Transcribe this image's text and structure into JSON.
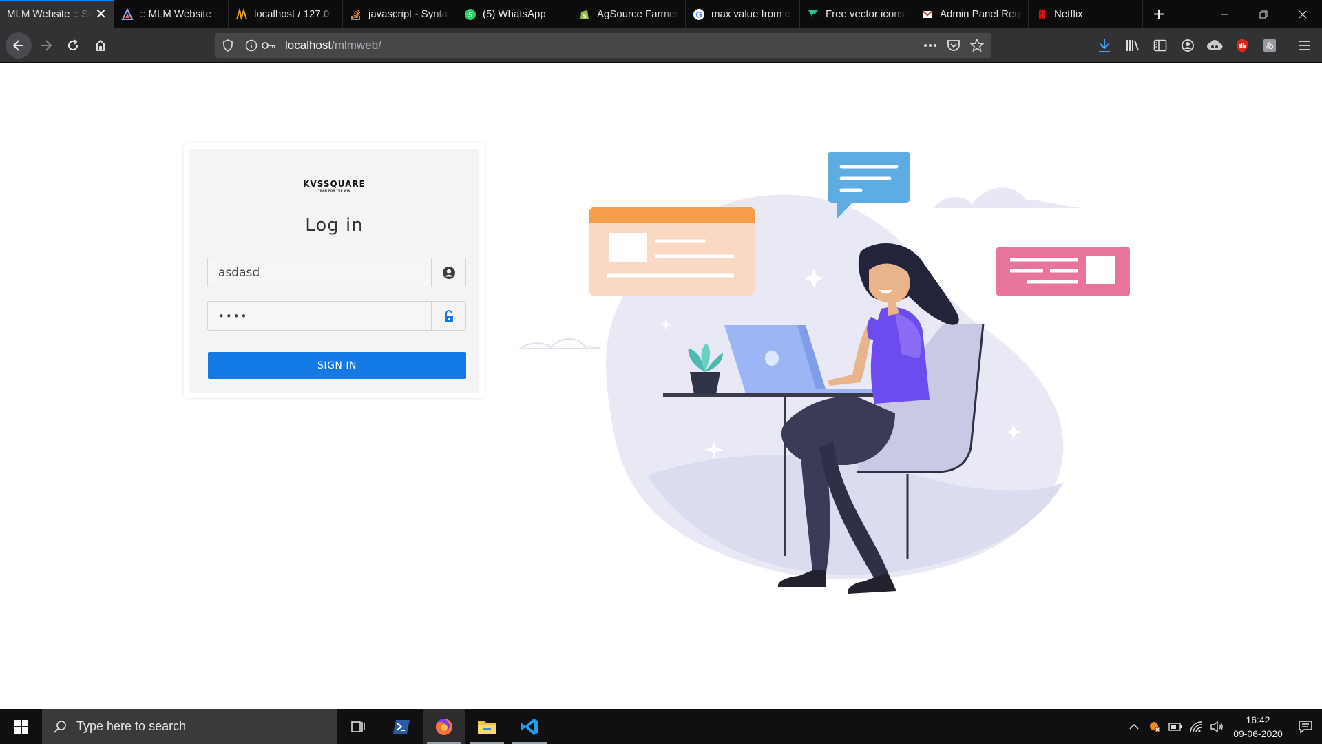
{
  "browser": {
    "tabs": [
      {
        "label": "MLM Website :: Si",
        "icon": "logo-icon",
        "active": true
      },
      {
        "label": ":: MLM Website ::",
        "icon": "triangle-logo-icon"
      },
      {
        "label": "localhost / 127.0",
        "icon": "phpmyadmin-icon"
      },
      {
        "label": "javascript - Synta",
        "icon": "stackoverflow-icon"
      },
      {
        "label": "(5) WhatsApp",
        "icon": "whatsapp-icon"
      },
      {
        "label": "AgSource Farmer",
        "icon": "shopify-icon"
      },
      {
        "label": "max value from c",
        "icon": "google-icon"
      },
      {
        "label": "Free vector icons",
        "icon": "flaticon-icon"
      },
      {
        "label": "Admin Panel Req",
        "icon": "gmail-icon"
      },
      {
        "label": "Netflix",
        "icon": "netflix-icon"
      }
    ],
    "url_host": "localhost",
    "url_path": "/mlmweb/"
  },
  "login": {
    "brand_name": "KVSSQUARE",
    "brand_tagline": "TEAM FOR THE WIN",
    "title": "Log in",
    "username_value": "asdasd",
    "password_mask": "••••",
    "signin_label": "SIGN IN"
  },
  "taskbar": {
    "search_placeholder": "Type here to search",
    "time": "16:42",
    "date": "09-06-2020"
  },
  "colors": {
    "accent": "#1279e5",
    "tab_active_indicator": "#0a84ff"
  }
}
